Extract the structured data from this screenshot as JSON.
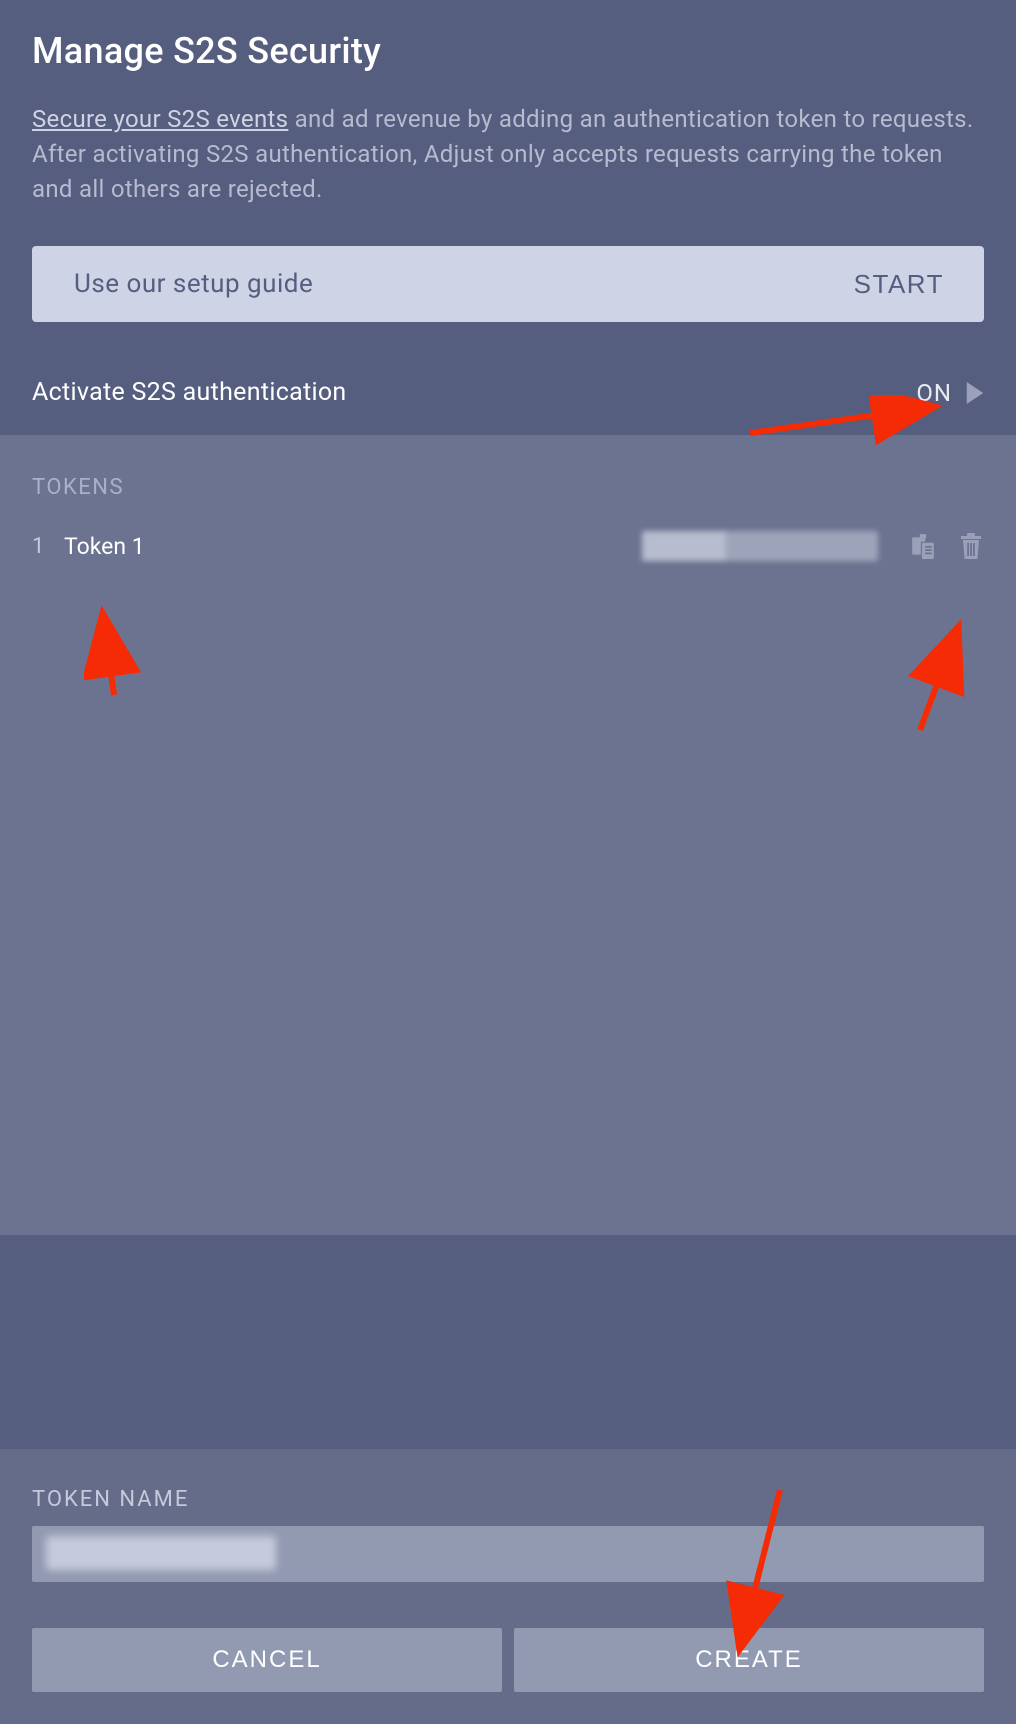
{
  "page": {
    "title": "Manage S2S Security",
    "desc_link_text": "Secure your S2S events",
    "desc_rest": " and ad revenue by adding an authentication token to requests. After activating S2S authentication, Adjust only accepts requests carrying the token and all others are rejected."
  },
  "guide": {
    "text": "Use our setup guide",
    "start_label": "START"
  },
  "activate": {
    "label": "Activate S2S authentication",
    "state_label": "ON"
  },
  "tokens": {
    "section_label": "TOKENS",
    "items": [
      {
        "index": "1",
        "name": "Token 1"
      }
    ]
  },
  "form": {
    "label": "TOKEN NAME",
    "cancel_label": "CANCEL",
    "create_label": "CREATE"
  }
}
